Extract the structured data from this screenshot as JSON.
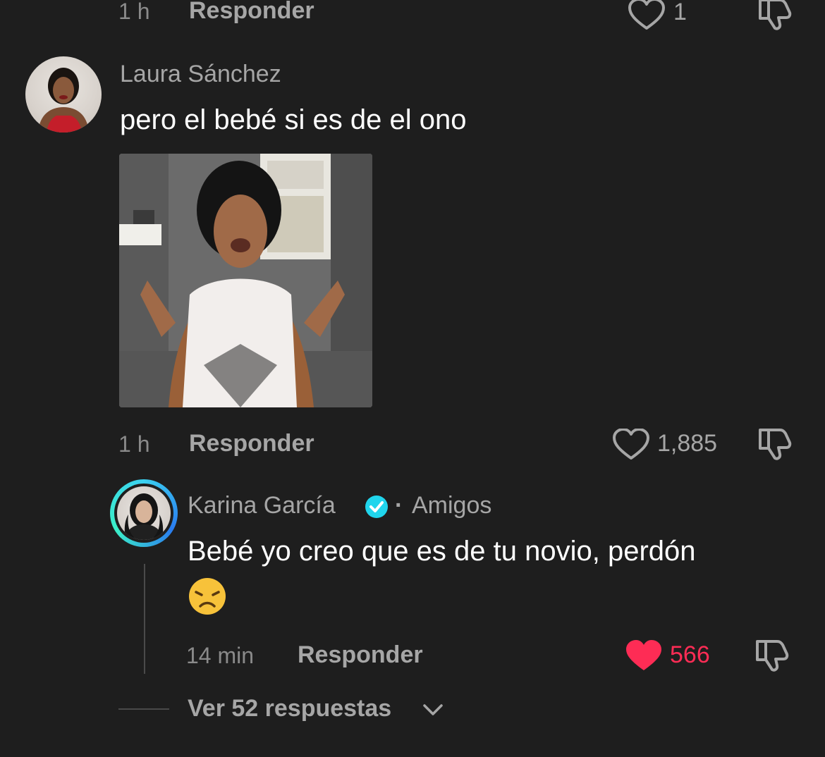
{
  "top_row": {
    "time": "1 h",
    "reply_label": "Responder",
    "like_count": "1"
  },
  "comment1": {
    "author": "Laura Sánchez",
    "text": "pero el bebé si es de el ono",
    "time": "1 h",
    "reply_label": "Responder",
    "like_count": "1,885",
    "liked": false
  },
  "reply1": {
    "author": "Karina García",
    "verified": true,
    "relation": "Amigos",
    "separator": "·",
    "text": "Bebé yo creo que es de tu novio, perdón",
    "emoji": "😞",
    "time": "14 min",
    "reply_label": "Responder",
    "like_count": "566",
    "liked": true
  },
  "view_replies": {
    "label": "Ver 52 respuestas"
  },
  "colors": {
    "background": "#1e1e1e",
    "muted_text": "#a6a6a6",
    "like_red": "#fe2c55",
    "verified_blue": "#20d5ec"
  }
}
